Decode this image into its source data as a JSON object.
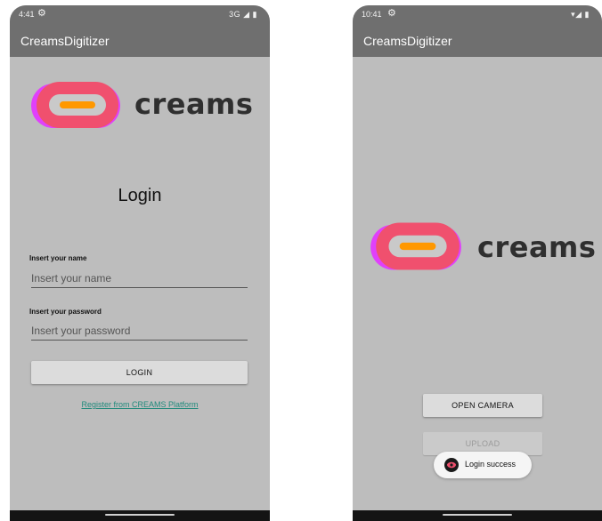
{
  "login_screen": {
    "status": {
      "time": "4:41",
      "right": "3G ◢ ▮"
    },
    "app_title": "CreamsDigitizer",
    "logo_text": "creams",
    "heading": "Login",
    "name_label": "Insert your name",
    "name_placeholder": "Insert your name",
    "password_label": "Insert your password",
    "password_placeholder": "Insert your password",
    "login_button": "LOGIN",
    "register_link": "Register from CREAMS Platform"
  },
  "home_screen": {
    "status": {
      "time": "10:41",
      "right": "▾◢ ▮"
    },
    "app_title": "CreamsDigitizer",
    "logo_text": "creams",
    "open_camera_button": "OPEN CAMERA",
    "upload_button": "UPLOAD",
    "toast_text": "Login success"
  },
  "icons": {
    "status_gear": "gear-icon",
    "logo_mark": "creams-logo-icon",
    "toast_app": "app-eye-icon"
  },
  "colors": {
    "background": "#bdbdbd",
    "app_bar": "#6f6f6f",
    "logo_pink": "#f0506e",
    "logo_magenta": "#e040fb",
    "logo_orange": "#ff9800",
    "link": "#218a7c",
    "nav_bar": "#141414"
  }
}
